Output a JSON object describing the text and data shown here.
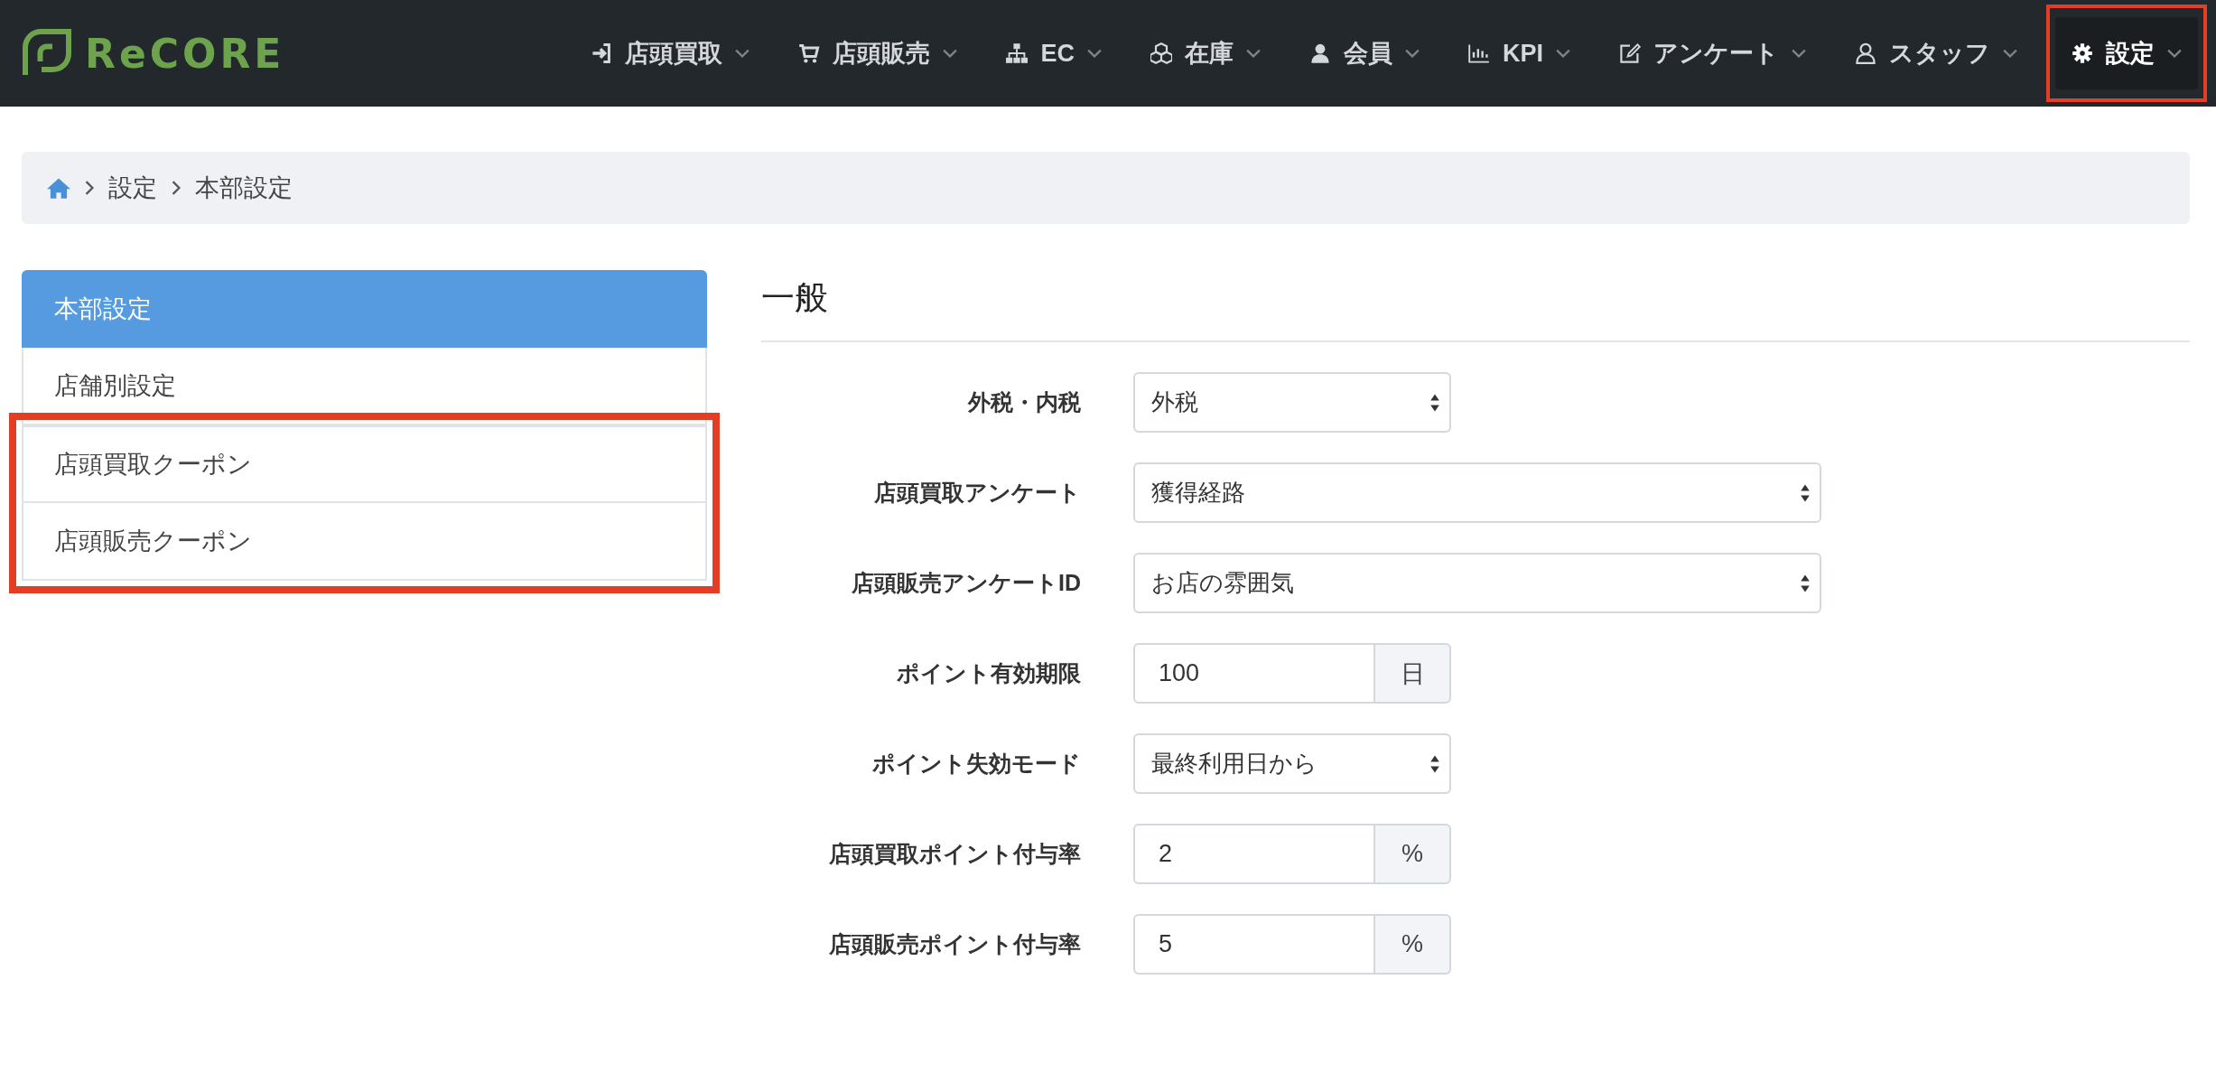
{
  "header": {
    "logo": "ReCORE",
    "nav": [
      {
        "label": "店頭買取",
        "selected": false,
        "highlighted": false
      },
      {
        "label": "店頭販売",
        "selected": false,
        "highlighted": false
      },
      {
        "label": "EC",
        "selected": false,
        "highlighted": false
      },
      {
        "label": "在庫",
        "selected": false,
        "highlighted": false
      },
      {
        "label": "会員",
        "selected": false,
        "highlighted": false
      },
      {
        "label": "KPI",
        "selected": false,
        "highlighted": false
      },
      {
        "label": "アンケート",
        "selected": false,
        "highlighted": false
      },
      {
        "label": "スタッフ",
        "selected": false,
        "highlighted": false
      },
      {
        "label": "設定",
        "selected": true,
        "highlighted": true
      }
    ]
  },
  "breadcrumb": [
    "設定",
    "本部設定"
  ],
  "sidebar": {
    "items": [
      {
        "label": "本部設定",
        "selected": true,
        "highlighted": false
      },
      {
        "label": "店舗別設定",
        "selected": false,
        "highlighted": false
      },
      {
        "label": "店頭買取クーポン",
        "selected": false,
        "highlighted": true
      },
      {
        "label": "店頭販売クーポン",
        "selected": false,
        "highlighted": true
      }
    ]
  },
  "section": {
    "title": "一般",
    "fields": [
      {
        "label": "外税・内税",
        "kind": "select",
        "value": "外税"
      },
      {
        "label": "店頭買取アンケート",
        "kind": "select-wide",
        "value": "獲得経路"
      },
      {
        "label": "店頭販売アンケートID",
        "kind": "select-wide",
        "value": "お店の雰囲気"
      },
      {
        "label": "ポイント有効期限",
        "kind": "addon",
        "value": "100",
        "addon": "日"
      },
      {
        "label": "ポイント失効モード",
        "kind": "select",
        "value": "最終利用日から"
      },
      {
        "label": "店頭買取ポイント付与率",
        "kind": "addon",
        "value": "2",
        "addon": "%"
      },
      {
        "label": "店頭販売ポイント付与率",
        "kind": "addon",
        "value": "5",
        "addon": "%"
      }
    ]
  }
}
